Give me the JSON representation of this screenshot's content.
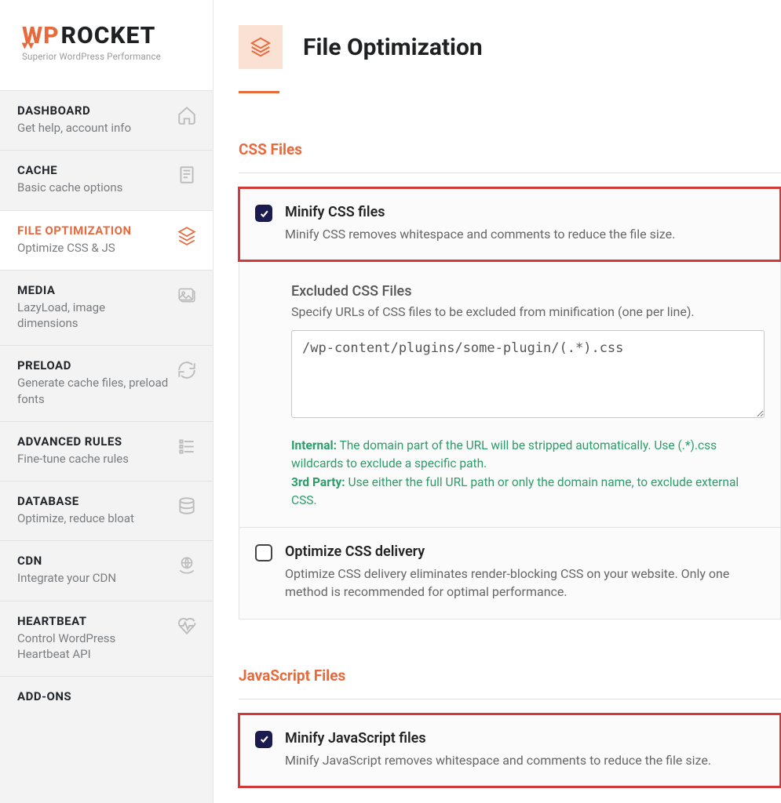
{
  "brand": {
    "name_a": "WP",
    "name_b": " ROCKET",
    "tagline": "Superior WordPress Performance"
  },
  "sidebar": {
    "items": [
      {
        "title": "DASHBOARD",
        "sub": "Get help, account info",
        "icon": "home-icon"
      },
      {
        "title": "CACHE",
        "sub": "Basic cache options",
        "icon": "file-icon"
      },
      {
        "title": "FILE OPTIMIZATION",
        "sub": "Optimize CSS & JS",
        "icon": "layers-icon",
        "active": true
      },
      {
        "title": "MEDIA",
        "sub": "LazyLoad, image dimensions",
        "icon": "images-icon"
      },
      {
        "title": "PRELOAD",
        "sub": "Generate cache files, preload fonts",
        "icon": "refresh-icon"
      },
      {
        "title": "ADVANCED RULES",
        "sub": "Fine-tune cache rules",
        "icon": "sliders-icon"
      },
      {
        "title": "DATABASE",
        "sub": "Optimize, reduce bloat",
        "icon": "database-icon"
      },
      {
        "title": "CDN",
        "sub": "Integrate your CDN",
        "icon": "globe-hand-icon"
      },
      {
        "title": "HEARTBEAT",
        "sub": "Control WordPress Heartbeat API",
        "icon": "heartbeat-icon"
      },
      {
        "title": "ADD-ONS",
        "sub": "",
        "icon": ""
      }
    ]
  },
  "page": {
    "title": "File Optimization"
  },
  "sections": {
    "css": {
      "title": "CSS Files",
      "minify": {
        "checked": true,
        "title": "Minify CSS files",
        "desc": "Minify CSS removes whitespace and comments to reduce the file size."
      },
      "excluded": {
        "title": "Excluded CSS Files",
        "desc": "Specify URLs of CSS files to be excluded from minification (one per line).",
        "value": "/wp-content/plugins/some-plugin/(.*).css",
        "hint_internal_label": "Internal:",
        "hint_internal_text": " The domain part of the URL will be stripped automatically. Use (.*).css wildcards to exclude a specific path.",
        "hint_3rd_label": "3rd Party:",
        "hint_3rd_text": " Use either the full URL path or only the domain name, to exclude external CSS."
      },
      "optimize_delivery": {
        "checked": false,
        "title": "Optimize CSS delivery",
        "desc": "Optimize CSS delivery eliminates render-blocking CSS on your website. Only one method is recommended for optimal performance."
      }
    },
    "js": {
      "title": "JavaScript Files",
      "minify": {
        "checked": true,
        "title": "Minify JavaScript files",
        "desc": "Minify JavaScript removes whitespace and comments to reduce the file size."
      }
    }
  }
}
